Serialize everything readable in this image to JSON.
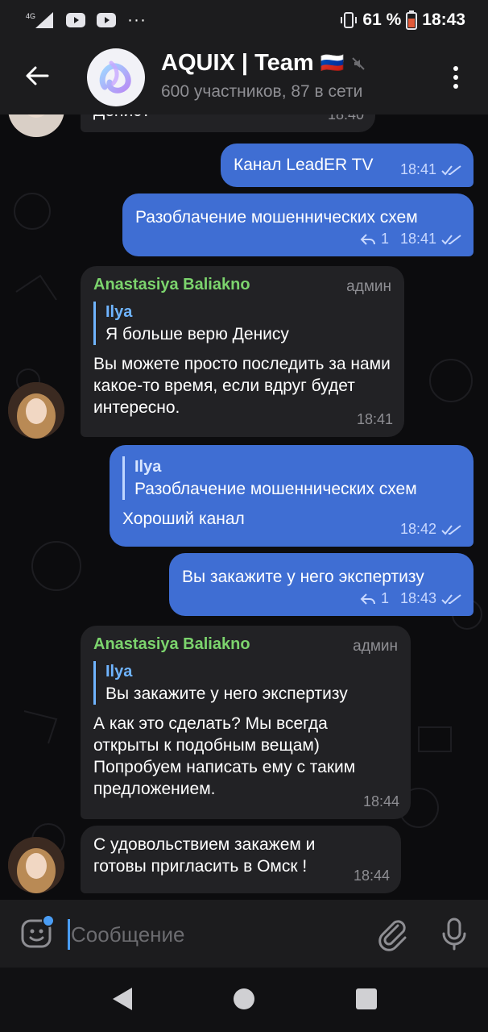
{
  "status": {
    "network": "4G",
    "battery": "61 %",
    "time": "18:43"
  },
  "header": {
    "title": "AQUIX | Team",
    "flag": "🇷🇺",
    "subtitle": "600 участников, 87 в сети"
  },
  "messages": {
    "m0": {
      "text": "Денис?",
      "time": "18:40"
    },
    "m1": {
      "text": "Канал LeadER TV",
      "time": "18:41"
    },
    "m2": {
      "text": "Разоблачение мошеннических схем",
      "replies": "1",
      "time": "18:41"
    },
    "m3": {
      "sender": "Anastasiya Baliakno",
      "role": "админ",
      "quote_name": "Ilya",
      "quote_text": "Я больше верю Денису",
      "text": "Вы можете просто последить за нами какое-то время, если вдруг будет интересно.",
      "time": "18:41"
    },
    "m4": {
      "quote_name": "Ilya",
      "quote_text": "Разоблачение мошеннических схем",
      "text": "Хороший канал",
      "time": "18:42"
    },
    "m5": {
      "text": "Вы закажите у него экспертизу",
      "replies": "1",
      "time": "18:43"
    },
    "m6": {
      "sender": "Anastasiya Baliakno",
      "role": "админ",
      "quote_name": "Ilya",
      "quote_text": "Вы закажите у него экспертизу",
      "text": "А как это сделать? Мы всегда открыты к подобным вещам) Попробуем написать ему с таким предложением.",
      "time": "18:44"
    },
    "m7": {
      "text": "С удовольствием закажем и готовы пригласить в Омск !",
      "time": "18:44"
    }
  },
  "input": {
    "placeholder": "Сообщение"
  },
  "colors": {
    "outgoing": "#3f6ed3",
    "incoming": "#222225",
    "sender": "#7cd46d",
    "accent": "#4a9df5"
  },
  "icons": [
    "back-arrow-icon",
    "mute-icon",
    "more-vert-icon",
    "reply-icon",
    "read-ticks-icon",
    "emoji-icon",
    "attach-icon",
    "mic-icon",
    "nav-back-icon",
    "nav-home-icon",
    "nav-recents-icon"
  ]
}
